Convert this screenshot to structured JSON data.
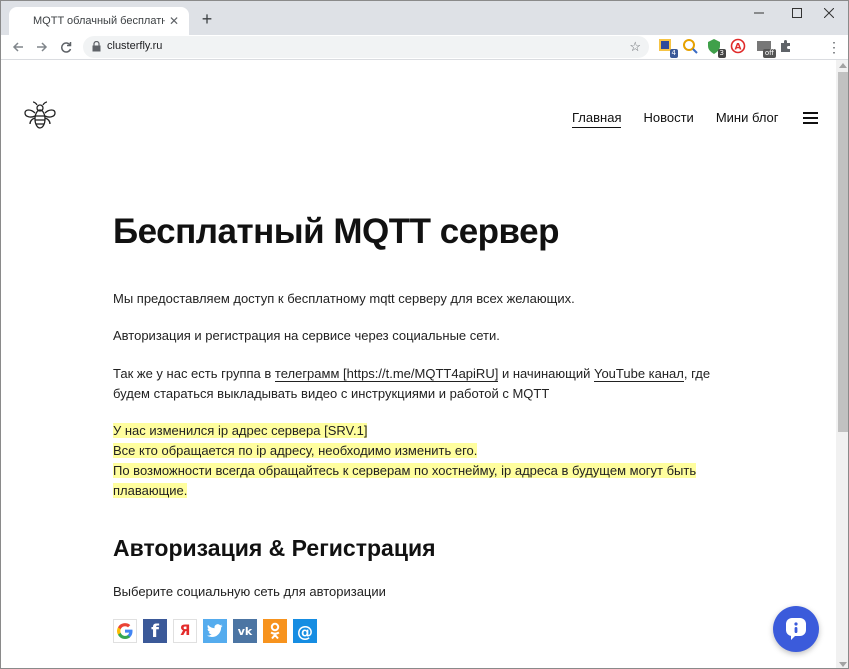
{
  "browser": {
    "tab_title": "MQTT облачный бесплатный се",
    "url": "clusterfly.ru",
    "extension_badges": {
      "ext1": "4",
      "ext3": "3",
      "ext5": "off"
    }
  },
  "site": {
    "nav": [
      {
        "label": "Главная"
      },
      {
        "label": "Новости"
      },
      {
        "label": "Мини блог"
      }
    ]
  },
  "content": {
    "title": "Бесплатный MQTT сервер",
    "para1": "Мы предоставляем доступ к бесплатному mqtt серверу для всех желающих.",
    "para2": "Авторизация и регистрация на сервисе через социальные сети.",
    "para3_before": "Так же у нас есть группа в ",
    "para3_link1": "телеграмм [https://t.me/MQTT4apiRU]",
    "para3_mid": " и начинающий ",
    "para3_link2": "YouTube канал",
    "para3_after": ", где будем стараться выкладывать видео с инструкциями и работой с MQTT",
    "notice1": "У нас изменился ip адрес сервера [SRV.1]",
    "notice2": "Все кто обращается по ip адресу, необходимо изменить его.",
    "notice3": "По возможности всегда обращайтесь к серверам по хостнейму, ip адреса в будущем могут быть плавающие.",
    "h2": "Авторизация & Регистрация",
    "choose": "Выберите социальную сеть для авторизации"
  },
  "socials": [
    {
      "name": "google",
      "glyph": "G",
      "color": "#ffffff"
    },
    {
      "name": "facebook",
      "glyph": "f",
      "color": "#3b5998"
    },
    {
      "name": "yandex",
      "glyph": "Я",
      "color": "#ffffff"
    },
    {
      "name": "twitter",
      "glyph": "t",
      "color": "#55acee"
    },
    {
      "name": "vk",
      "glyph": "vk",
      "color": "#4c75a3"
    },
    {
      "name": "odnoklassniki",
      "glyph": "ok",
      "color": "#f7931e"
    },
    {
      "name": "mail",
      "glyph": "@",
      "color": "#168de2"
    }
  ],
  "colors": {
    "highlight": "#fffe9e",
    "chat_button": "#3b5bdb",
    "link_underline": "#222222"
  }
}
